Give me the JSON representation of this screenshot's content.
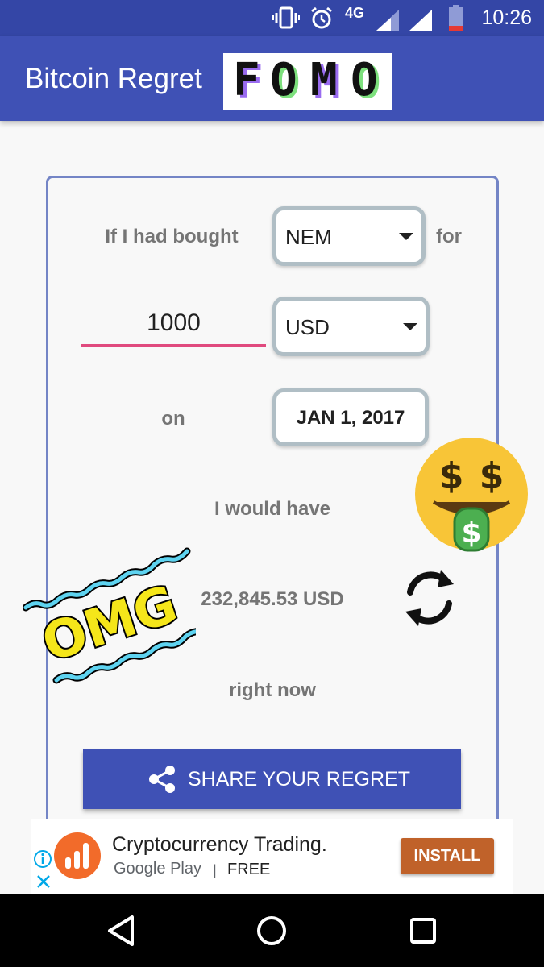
{
  "status_bar": {
    "time": "10:26",
    "network": "4G",
    "icons": [
      "vibrate-icon",
      "alarm-icon",
      "signal-icon",
      "wifi-icon",
      "battery-icon"
    ]
  },
  "app_bar": {
    "title": "Bitcoin Regret",
    "badge_letters": [
      "F",
      "O",
      "M",
      "O"
    ]
  },
  "form": {
    "label_bought": "If I had bought",
    "coin_value": "NEM",
    "label_for": "for",
    "amount_value": "1000",
    "currency_value": "USD",
    "label_on": "on",
    "date_value": "JAN 1, 2017",
    "label_would_have": "I would have",
    "result_value": "232,845.53 USD",
    "label_right_now": "right now",
    "share_label": "SHARE YOUR REGRET"
  },
  "stickers": {
    "omg_text": "OMG",
    "money_face": "money-mouth-face-icon",
    "refresh": "refresh-icon"
  },
  "ad": {
    "title": "Cryptocurrency Trading.",
    "store_google": "Google",
    "store_play": "Play",
    "separator": "|",
    "price": "FREE",
    "install_label": "INSTALL"
  },
  "colors": {
    "primary": "#3f51b5",
    "status_bar": "#3446a6",
    "input_underline": "#e04a7e",
    "install": "#c0622a",
    "card_border": "#7485c6"
  }
}
